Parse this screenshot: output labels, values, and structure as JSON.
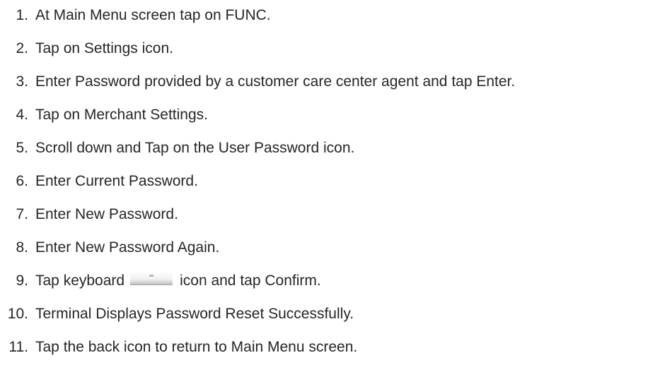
{
  "instructions": {
    "steps": [
      {
        "number": "1.",
        "text": "At Main Menu screen tap on FUNC."
      },
      {
        "number": "2.",
        "text": "Tap on Settings icon."
      },
      {
        "number": "3.",
        "text": "Enter Password provided by a customer care center agent and tap Enter."
      },
      {
        "number": "4.",
        "text": "Tap on Merchant Settings."
      },
      {
        "number": "5.",
        "text": "Scroll down and Tap on the User Password icon."
      },
      {
        "number": "6.",
        "text": "Enter Current Password."
      },
      {
        "number": "7.",
        "text": "Enter New Password."
      },
      {
        "number": "8.",
        "text": "Enter New Password Again."
      },
      {
        "number": "9.",
        "text_before": "Tap keyboard",
        "icon": "keyboard-hide-icon",
        "text_after": "icon and tap Confirm."
      },
      {
        "number": "10.",
        "text": "Terminal Displays Password Reset Successfully."
      },
      {
        "number": "11.",
        "text": "Tap the back icon to return to Main Menu screen."
      }
    ]
  }
}
